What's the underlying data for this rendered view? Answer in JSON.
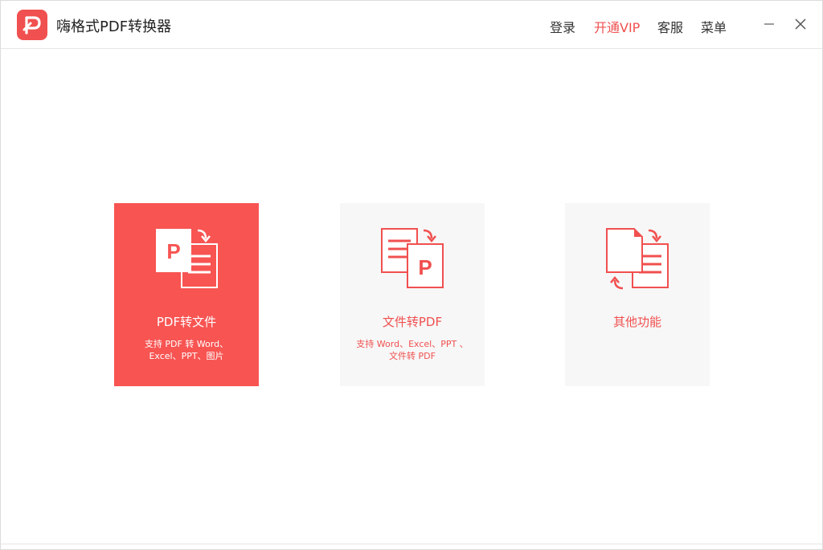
{
  "app": {
    "title": "嗨格式PDF转换器",
    "logo_icon": "pdf-p-logo-icon"
  },
  "header": {
    "login": "登录",
    "vip": "开通VIP",
    "service": "客服",
    "menu": "菜单",
    "minimize_icon": "minimize-icon",
    "close_icon": "close-icon"
  },
  "colors": {
    "accent": "#f0504f",
    "card_active_bg": "#f75452",
    "card_bg": "#f7f7f7"
  },
  "cards": [
    {
      "label": "PDF转文件",
      "desc": [
        "支持 PDF 转 Word、",
        "Excel、PPT、图片"
      ],
      "icon": "pdf-to-file-icon",
      "active": true
    },
    {
      "label": "文件转PDF",
      "desc": [
        "支持 Word、Excel、PPT 、",
        "文件转 PDF"
      ],
      "icon": "file-to-pdf-icon",
      "active": false
    },
    {
      "label": "其他功能",
      "desc": [],
      "icon": "other-functions-icon",
      "active": false
    }
  ]
}
